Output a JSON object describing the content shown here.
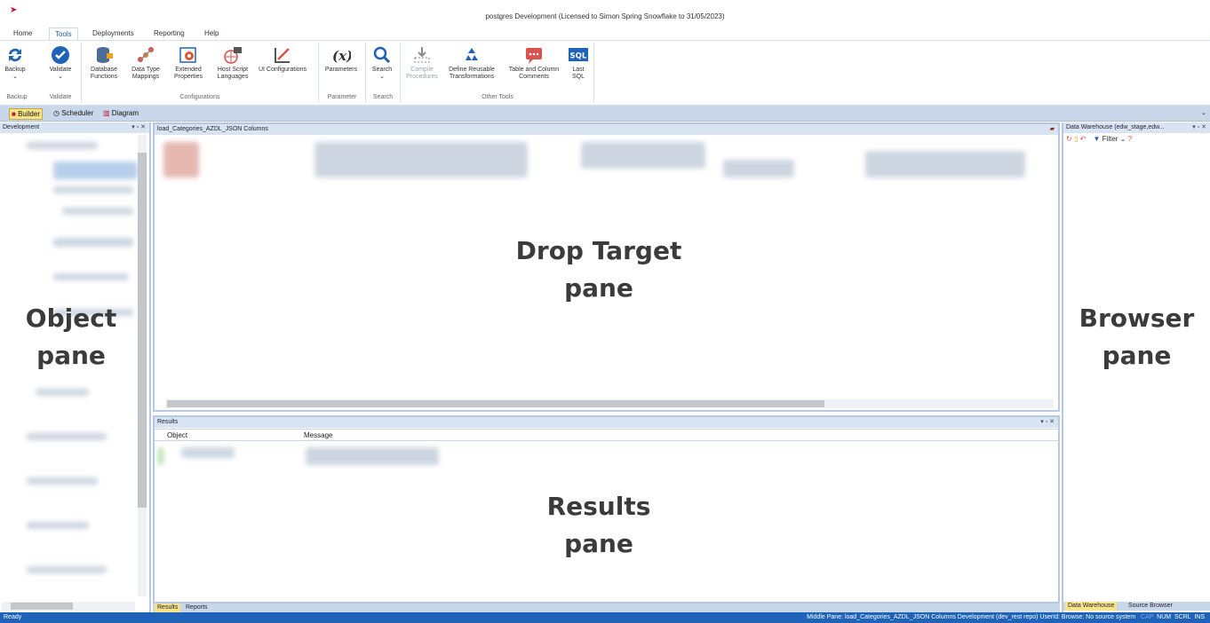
{
  "window": {
    "title": "postgres  Development  (Licensed to Simon Spring Snowflake to 31/05/2023)",
    "licensee_obscured": "Simon Spring"
  },
  "tabs": [
    "Home",
    "Tools",
    "Deployments",
    "Reporting",
    "Help"
  ],
  "active_tab": "Tools",
  "ribbon": {
    "buttons": [
      {
        "id": "backup",
        "label": "Backup",
        "icon": "refresh-icon"
      },
      {
        "id": "validate",
        "label": "Validate",
        "icon": "check-circle-icon"
      },
      {
        "id": "db-functions",
        "label": "Database Functions",
        "icon": "database-icon"
      },
      {
        "id": "data-type-mappings",
        "label": "Data Type Mappings",
        "icon": "network-icon"
      },
      {
        "id": "extended-properties",
        "label": "Extended Properties",
        "icon": "settings-gear-icon"
      },
      {
        "id": "host-script-languages",
        "label": "Host Script Languages",
        "icon": "globe-script-icon"
      },
      {
        "id": "ui-configurations",
        "label": "UI Configurations",
        "icon": "ui-config-icon"
      },
      {
        "id": "parameters",
        "label": "Parameters",
        "icon": "function-x-icon"
      },
      {
        "id": "search",
        "label": "Search",
        "icon": "search-icon"
      },
      {
        "id": "compile-procedures",
        "label": "Compile Procedures",
        "icon": "download-icon"
      },
      {
        "id": "define-reusable-transformations",
        "label": "Define Reusable Transformations",
        "icon": "recycle-icon"
      },
      {
        "id": "table-column-comments",
        "label": "Table and Column Comments",
        "icon": "comment-icon"
      },
      {
        "id": "last-sql",
        "label": "Last SQL",
        "icon": "sql-icon"
      }
    ],
    "groups": [
      "Backup",
      "Validate",
      "Configurations",
      "Parameter",
      "Search",
      "Other Tools"
    ]
  },
  "modes": [
    "Builder",
    "Scheduler",
    "Diagram"
  ],
  "active_mode": "Builder",
  "left_pane": {
    "header": "Development",
    "label_line1": "Object",
    "label_line2": "pane"
  },
  "drop_pane": {
    "header": "load_Categories_AZDL_JSON Columns",
    "label_line1": "Drop Target",
    "label_line2": "pane"
  },
  "results_pane": {
    "header": "Results",
    "columns": [
      "Object",
      "Message"
    ],
    "label_line1": "Results",
    "label_line2": "pane",
    "tabs": [
      "Results",
      "Reports"
    ],
    "active_tab": "Results"
  },
  "right_pane": {
    "header": "Data Warehouse (edw_stage,edw...",
    "filter_label": "Filter",
    "label_line1": "Browser",
    "label_line2": "pane",
    "tabs": [
      "Data Warehouse",
      "Source Browser"
    ],
    "active_tab": "Data Warehouse"
  },
  "status_bar": {
    "left": "Ready",
    "right": "Middle Pane: load_Categories_AZDL_JSON Columns   Development (dev_rest repo)   UserId:   Browse: No source system",
    "keys": [
      "CAP",
      "NUM",
      "SCRL",
      "INS"
    ]
  },
  "colors": {
    "accent": "#1e63b8",
    "pane_border": "#b7c9e2",
    "highlight": "#f7e48a"
  }
}
